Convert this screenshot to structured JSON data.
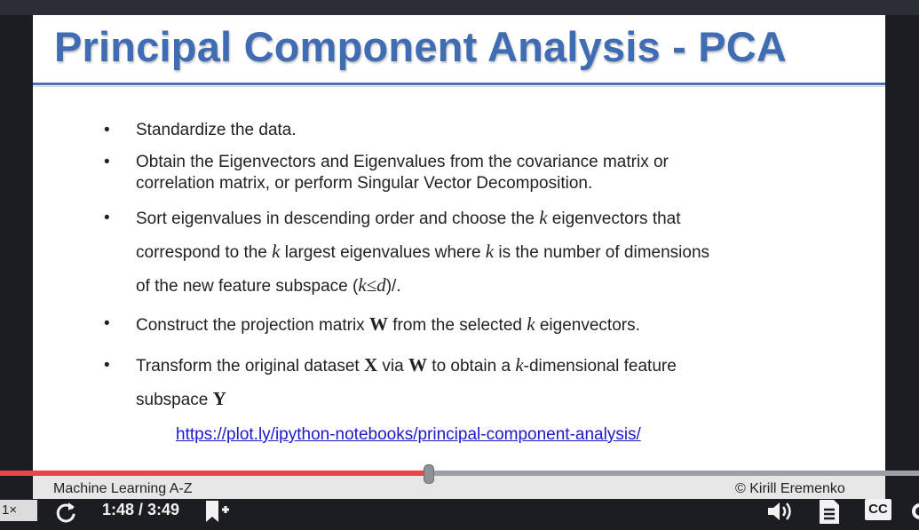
{
  "slide": {
    "title": "Principal Component Analysis - PCA",
    "bullets": [
      {
        "lines": [
          [
            "Standardize the data."
          ]
        ]
      },
      {
        "lines": [
          [
            "Obtain the Eigenvectors and Eigenvalues from the covariance matrix or"
          ],
          [
            "correlation matrix, or perform Singular Vector Decomposition."
          ]
        ]
      },
      {
        "lines": [
          [
            "Sort eigenvalues in descending order and choose the ",
            {
              "m": "k"
            },
            " eigenvectors that"
          ],
          [
            "correspond to the ",
            {
              "m": "k"
            },
            " largest eigenvalues where ",
            {
              "m": "k"
            },
            " is the number of dimensions"
          ],
          [
            "of the new feature subspace (",
            {
              "m": "k≤d"
            },
            ")/."
          ]
        ]
      },
      {
        "lines": [
          [
            "Construct the projection matrix ",
            {
              "b": "W"
            },
            " from the selected ",
            {
              "m": "k"
            },
            " eigenvectors."
          ]
        ]
      },
      {
        "lines": [
          [
            "Transform the original dataset ",
            {
              "b": "X"
            },
            " via ",
            {
              "b": "W"
            },
            " to obtain a ",
            {
              "m": "k"
            },
            "-dimensional feature"
          ],
          [
            "subspace ",
            {
              "b": "Y"
            }
          ]
        ]
      }
    ],
    "link": "https://plot.ly/ipython-notebooks/principal-component-analysis/",
    "footer_left": "Machine Learning A-Z",
    "footer_right": "© Kirill Eremenko"
  },
  "player": {
    "speed_label": "1×",
    "time_display": "1:48 / 3:49",
    "progress_fraction": 0.465,
    "colors": {
      "progress": "#e8474a",
      "track": "#9aa0a6",
      "background": "#1b1d21"
    },
    "icons": [
      "rewind-icon",
      "bookmark-add-icon",
      "volume-icon",
      "transcript-icon",
      "captions-icon",
      "settings-icon"
    ],
    "captions_label": "CC"
  }
}
